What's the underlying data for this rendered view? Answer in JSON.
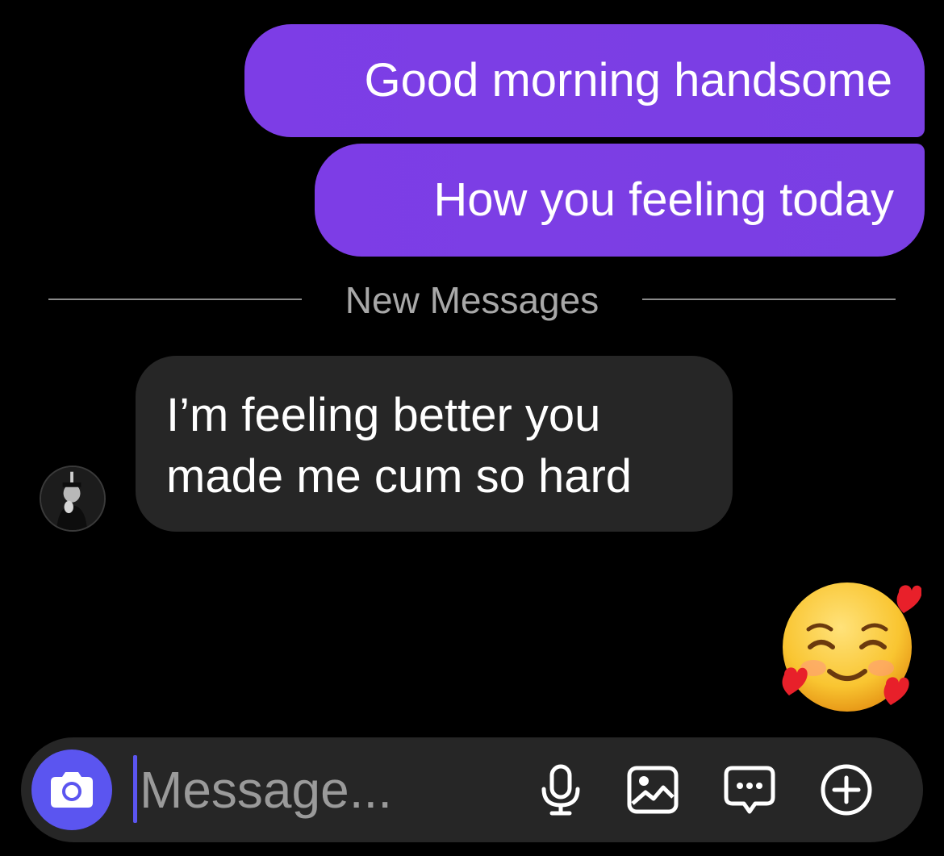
{
  "chat": {
    "sent_messages": [
      "Good morning handsome",
      "How you feeling today"
    ],
    "divider_label": "New Messages",
    "received_message": {
      "line1": "I’m feeling better you",
      "line2": "made me cum so hard"
    },
    "reaction_emoji": "smiling-face-with-hearts"
  },
  "composer": {
    "placeholder": "Message...",
    "value": "",
    "icons": [
      "camera-icon",
      "microphone-icon",
      "gallery-icon",
      "sticker-icon",
      "plus-icon"
    ],
    "accent_color": "#5b55f0"
  },
  "colors": {
    "sent_bubble": "#7d3de6",
    "received_bubble": "#262626",
    "background": "#000000"
  }
}
